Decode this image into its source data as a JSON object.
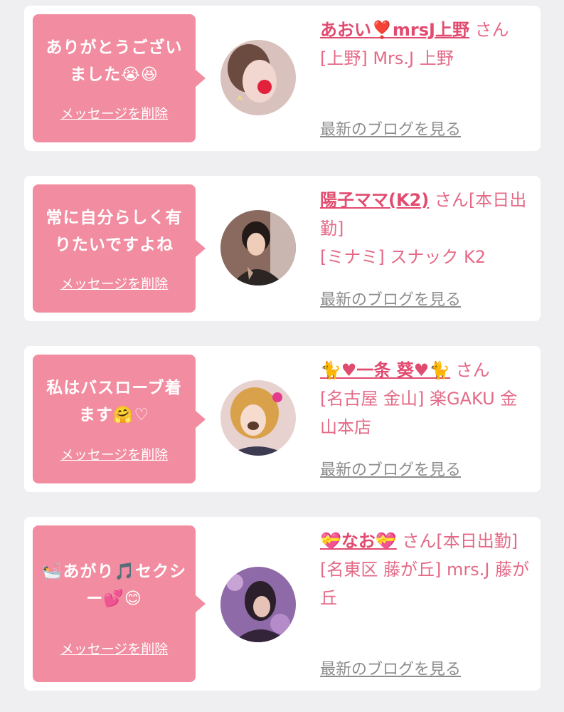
{
  "cards": [
    {
      "message": "ありがとうございました😭😆",
      "delete_label": "メッセージを削除",
      "name": "あおい❣️mrsJ上野",
      "suffix": "さん",
      "shop": "[上野] Mrs.J 上野",
      "blog_label": "最新のブログを見る"
    },
    {
      "message": "常に自分らしく有りたいですよね",
      "delete_label": "メッセージを削除",
      "name": "陽子ママ(K2)",
      "suffix": "さん[本日出勤]",
      "shop": "[ミナミ] スナック K2",
      "blog_label": "最新のブログを見る"
    },
    {
      "message": "私はバスローブ着ます🤗♡",
      "delete_label": "メッセージを削除",
      "name": "🐈♥一条 葵♥🐈",
      "suffix": "さん",
      "shop": "[名古屋 金山] 楽GAKU 金山本店",
      "blog_label": "最新のブログを見る"
    },
    {
      "message": "🛀あがり🎵セクシー💕😊",
      "delete_label": "メッセージを削除",
      "name": "💝なお💝",
      "suffix": "さん[本日出勤]",
      "shop": "[名東区 藤が丘] mrs.J 藤が丘",
      "blog_label": "最新のブログを見る"
    }
  ],
  "colors": {
    "page_bg": "#efeff1",
    "card_bg": "#ffffff",
    "bubble_bg": "#f28ca0",
    "accent_pink": "#e14b6f",
    "link_gray": "#8d8d8d"
  }
}
